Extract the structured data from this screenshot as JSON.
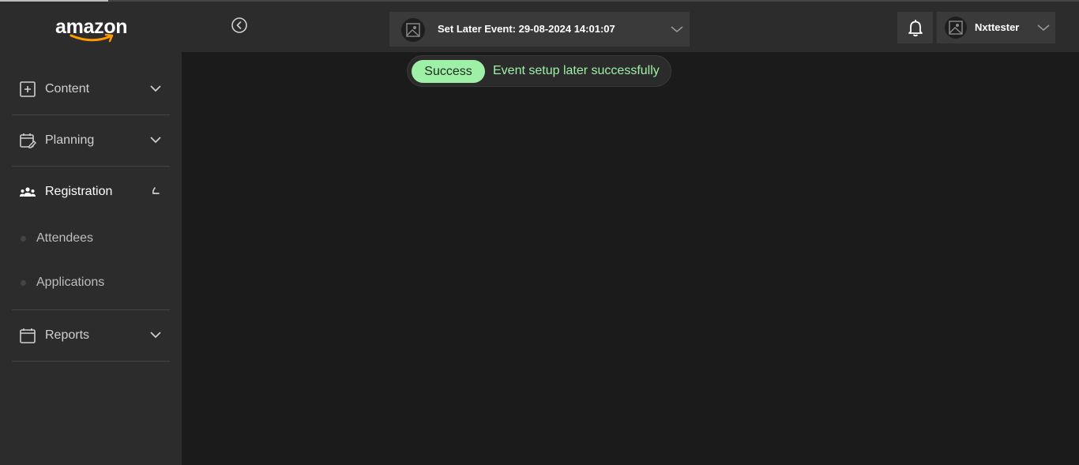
{
  "brand": {
    "logo_text": "amazon"
  },
  "header": {
    "event_selector": {
      "label": "Set Later Event: 29-08-2024 14:01:07"
    },
    "user": {
      "name": "Nxttester"
    }
  },
  "sidebar": {
    "items": [
      {
        "label": "Content",
        "icon": "plus-square-icon",
        "state": "collapsed"
      },
      {
        "label": "Planning",
        "icon": "calendar-edit-icon",
        "state": "collapsed"
      },
      {
        "label": "Registration",
        "icon": "people-icon",
        "state": "expanded",
        "children": [
          {
            "label": "Attendees"
          },
          {
            "label": "Applications"
          }
        ]
      },
      {
        "label": "Reports",
        "icon": "calendar-icon",
        "state": "collapsed"
      }
    ]
  },
  "toast": {
    "badge": "Success",
    "message": "Event setup later successfully"
  },
  "colors": {
    "sidebar_bg": "#2c2c2c",
    "main_bg": "#1b1b1b",
    "success_green": "#9ef0a6"
  }
}
